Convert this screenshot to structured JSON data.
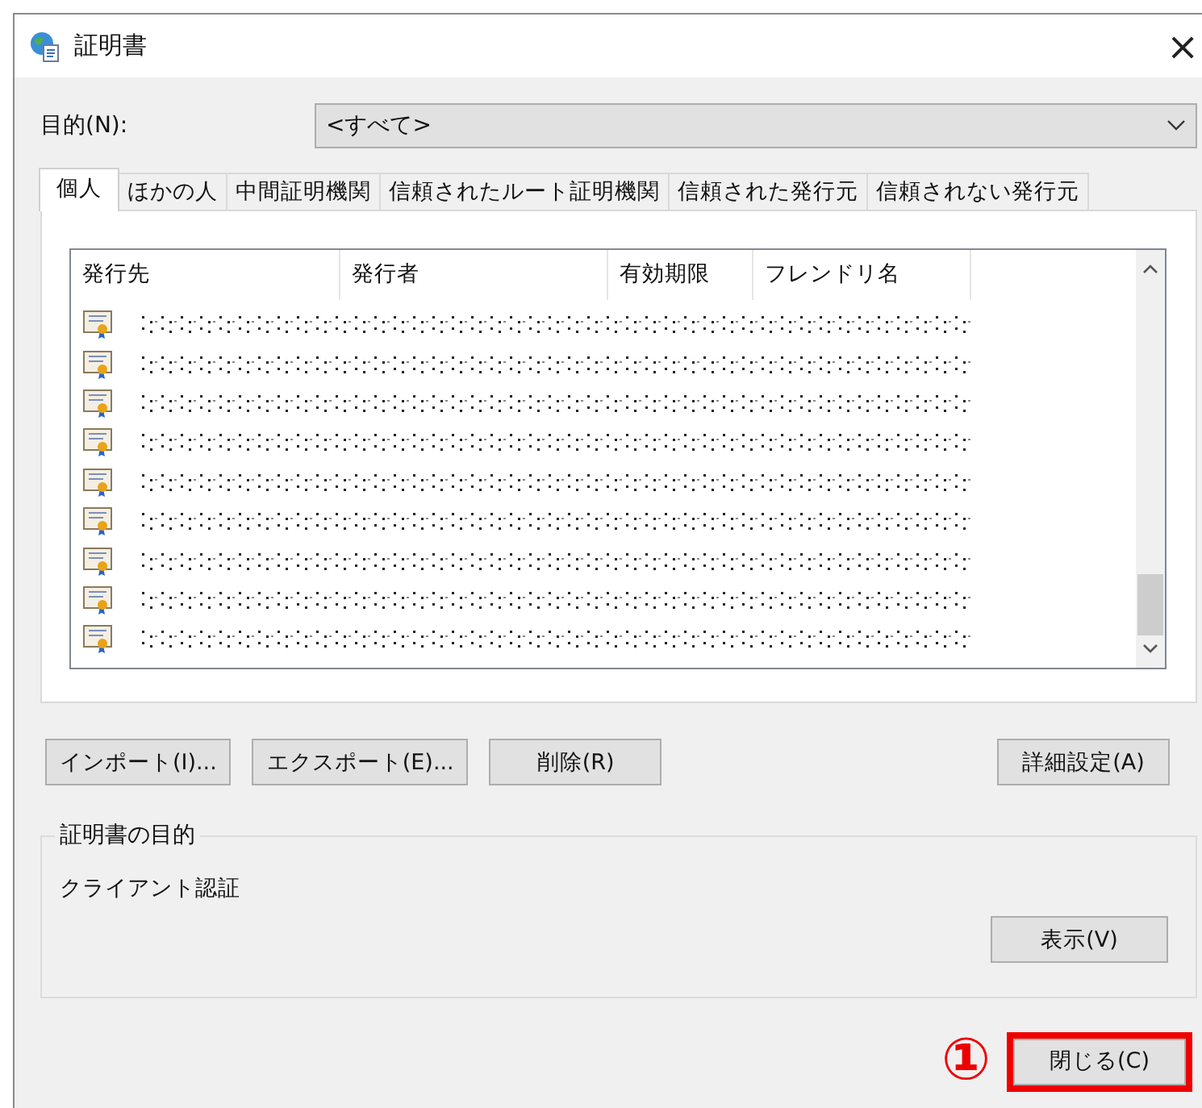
{
  "window": {
    "title": "証明書",
    "close": "×"
  },
  "purpose": {
    "label": "目的(N):",
    "value": "<すべて>"
  },
  "tabs": [
    {
      "label": "個人",
      "selected": true
    },
    {
      "label": "ほかの人",
      "selected": false
    },
    {
      "label": "中間証明機関",
      "selected": false
    },
    {
      "label": "信頼されたルート証明機関",
      "selected": false
    },
    {
      "label": "信頼された発行元",
      "selected": false
    },
    {
      "label": "信頼されない発行元",
      "selected": false
    }
  ],
  "table": {
    "columns": [
      "発行先",
      "発行者",
      "有効期限",
      "フレンドリ名"
    ],
    "rows": [
      {
        "masked": true
      },
      {
        "masked": true
      },
      {
        "masked": true
      },
      {
        "masked": true
      },
      {
        "masked": true
      },
      {
        "masked": true
      },
      {
        "masked": true
      },
      {
        "masked": true
      },
      {
        "masked": true
      }
    ]
  },
  "buttons": [
    "インポート(I)...",
    "エクスポート(E)...",
    "削除(R)"
  ],
  "advanced_button": "詳細設定(A)",
  "purpose_group": {
    "legend": "証明書の目的",
    "text": "クライアント認証",
    "view_button": "表示(V)"
  },
  "close_button": {
    "label": "閉じる(C)",
    "highlighted": true
  },
  "annotation": {
    "label": "①"
  }
}
